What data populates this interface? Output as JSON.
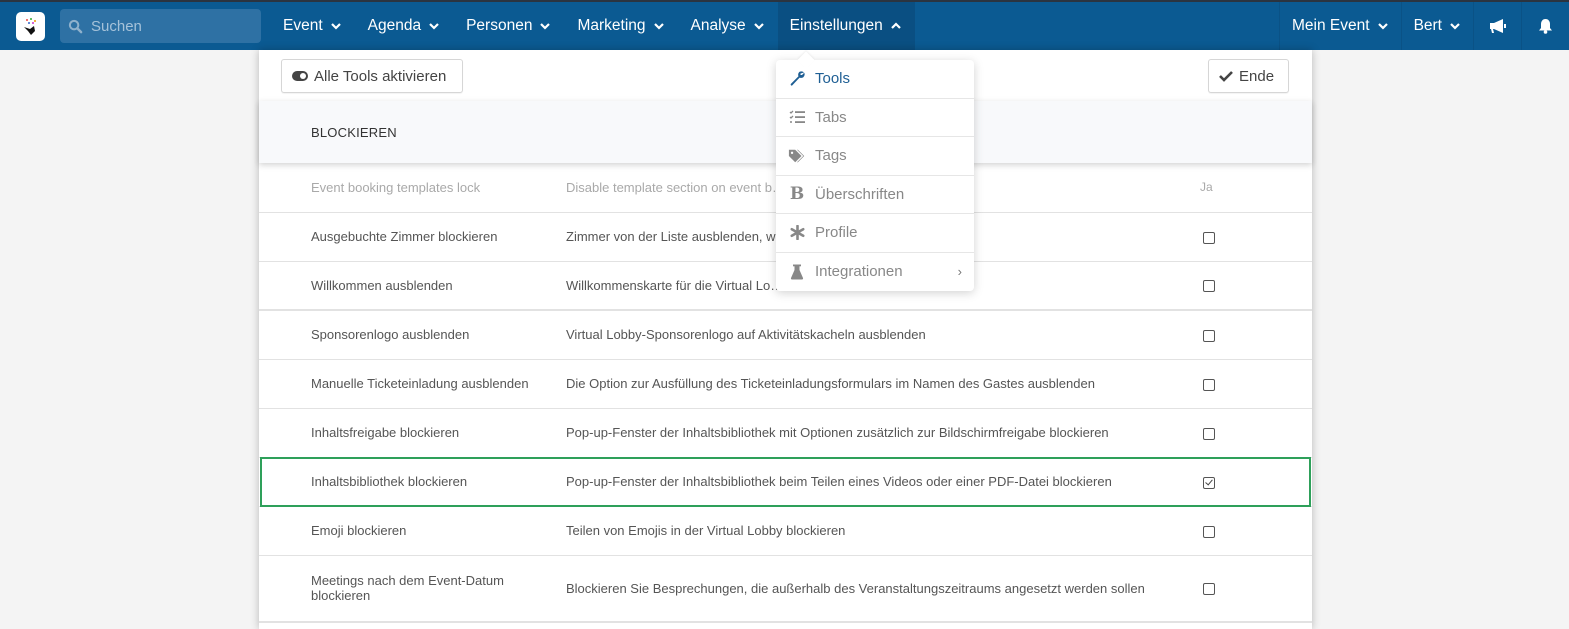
{
  "nav": {
    "search_placeholder": "Suchen",
    "items": [
      {
        "label": "Event",
        "state": "collapsed"
      },
      {
        "label": "Agenda",
        "state": "collapsed"
      },
      {
        "label": "Personen",
        "state": "collapsed"
      },
      {
        "label": "Marketing",
        "state": "collapsed"
      },
      {
        "label": "Analyse",
        "state": "collapsed"
      },
      {
        "label": "Einstellungen",
        "state": "expanded"
      }
    ],
    "right": {
      "event_label": "Mein Event",
      "user_label": "Bert",
      "icons": [
        "megaphone-icon",
        "bell-icon"
      ]
    },
    "colors": {
      "bar": "#0b5a92",
      "active": "#0a4f82",
      "search": "#2e71a4"
    }
  },
  "toolbar": {
    "toggle_all_label": "Alle Tools aktivieren",
    "done_label": "Ende"
  },
  "section": {
    "title": "BLOCKIEREN"
  },
  "dropdown": {
    "items": [
      {
        "label": "Tools",
        "icon": "wrench-icon",
        "active": true
      },
      {
        "label": "Tabs",
        "icon": "checklist-icon",
        "active": false
      },
      {
        "label": "Tags",
        "icon": "tags-icon",
        "active": false
      },
      {
        "label": "Überschriften",
        "icon": "bold-icon",
        "active": false
      },
      {
        "label": "Profile",
        "icon": "asterisk-icon",
        "active": false
      },
      {
        "label": "Integrationen",
        "icon": "flask-icon",
        "active": false,
        "has_submenu": true
      }
    ]
  },
  "rows": [
    {
      "name": "Event booking templates lock",
      "desc": "Disable template section on event b…",
      "value": "Ja",
      "faded": true
    },
    {
      "name": "Ausgebuchte Zimmer blockieren",
      "desc": "Zimmer von der Liste ausblenden, w…ben",
      "checked": false
    },
    {
      "name": "Willkommen ausblenden",
      "desc": "Willkommenskarte für die Virtual Lo… Video ausblenden",
      "checked": false
    },
    {
      "name": "Sponsorenlogo ausblenden",
      "desc": "Virtual Lobby-Sponsorenlogo auf Aktivitätskacheln ausblenden",
      "checked": false
    },
    {
      "name": "Manuelle Ticketeinladung ausblenden",
      "desc": "Die Option zur Ausfüllung des Ticketeinladungsformulars im Namen des Gastes ausblenden",
      "checked": false
    },
    {
      "name": "Inhaltsfreigabe blockieren",
      "desc": "Pop-up-Fenster der Inhaltsbibliothek mit Optionen zusätzlich zur Bildschirmfreigabe blockieren",
      "checked": false
    },
    {
      "name": "Inhaltsbibliothek blockieren",
      "desc": "Pop-up-Fenster der Inhaltsbibliothek beim Teilen eines Videos oder einer PDF-Datei blockieren",
      "checked": true,
      "highlighted": true
    },
    {
      "name": "Emoji blockieren",
      "desc": "Teilen von Emojis in der Virtual Lobby blockieren",
      "checked": false
    },
    {
      "name": "Meetings nach dem Event-Datum blockieren",
      "desc": "Blockieren Sie Besprechungen, die außerhalb des Veranstaltungszeitraums angesetzt werden sollen",
      "checked": false
    }
  ],
  "colors": {
    "highlight": "#2ea05a",
    "active_menu": "#1f5f94"
  }
}
